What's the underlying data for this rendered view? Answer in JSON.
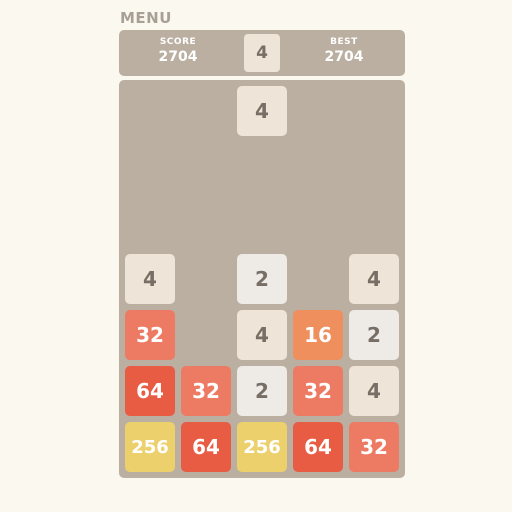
{
  "menu_label": "MENU",
  "score": {
    "label": "SCORE",
    "value": "2704"
  },
  "best": {
    "label": "BEST",
    "value": "2704"
  },
  "next_tile": "4",
  "board": {
    "falling_tile": {
      "value": "4",
      "column": 3
    },
    "rows": [
      [
        "4",
        "",
        "2",
        "",
        "4"
      ],
      [
        "32",
        "",
        "4",
        "16",
        "2"
      ],
      [
        "64",
        "32",
        "2",
        "32",
        "4"
      ],
      [
        "256",
        "64",
        "256",
        "64",
        "32"
      ]
    ]
  },
  "colors": {
    "background": "#fbf8f0",
    "board": "#bbafa2",
    "tile_2": "#eeebe6",
    "tile_4": "#eee4d7",
    "tile_16": "#ef8f5e",
    "tile_32": "#ed7a63",
    "tile_64": "#e85c44",
    "tile_256": "#ecd06c"
  }
}
